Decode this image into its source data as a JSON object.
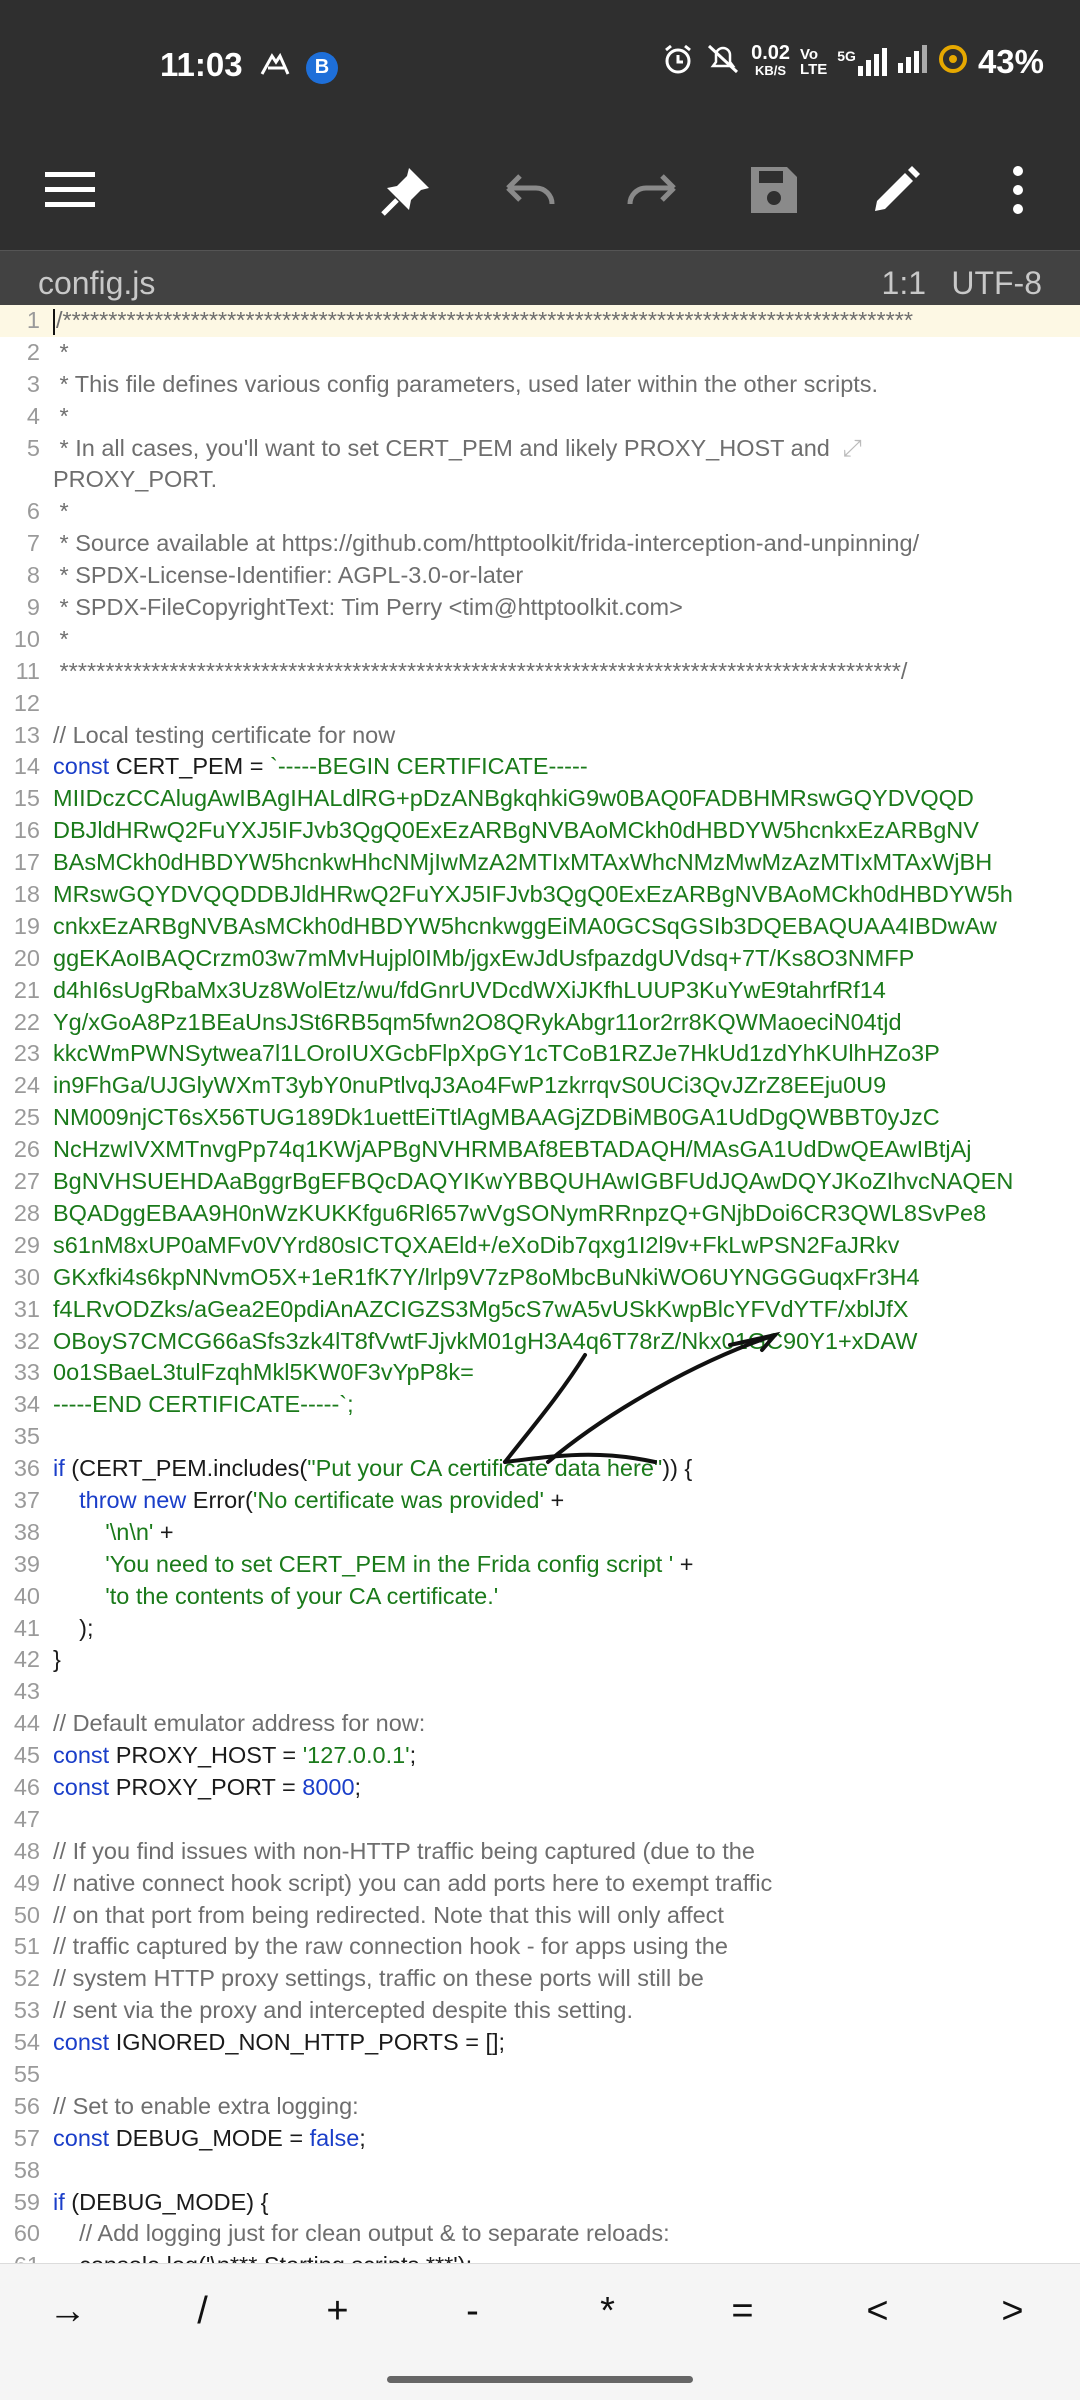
{
  "status_bar": {
    "time": "11:03",
    "net_speed_value": "0.02",
    "net_speed_unit": "KB/S",
    "vo_lte_top": "Vo",
    "vo_lte_bottom": "LTE",
    "network": "5G",
    "battery": "43%"
  },
  "toolbar": {
    "icons": [
      "menu-icon",
      "pin-icon",
      "undo-icon",
      "redo-icon",
      "save-icon",
      "edit-icon",
      "more-icon"
    ]
  },
  "file_bar": {
    "file_name": "config.js",
    "cursor_position": "1:1",
    "encoding": "UTF-8"
  },
  "code_lines": [
    {
      "n": "1",
      "type": "cmt",
      "text": "/*********************************************************************************************"
    },
    {
      "n": "2",
      "type": "cmt",
      "text": " *"
    },
    {
      "n": "3",
      "type": "cmt",
      "text": " * This file defines various config parameters, used later within the other scripts."
    },
    {
      "n": "4",
      "type": "cmt",
      "text": " *"
    },
    {
      "n": "5",
      "type": "cmt",
      "text": " * In all cases, you'll want to set CERT_PEM and likely PROXY_HOST and"
    },
    {
      "n": "",
      "type": "cmt",
      "text": "PROXY_PORT."
    },
    {
      "n": "6",
      "type": "cmt",
      "text": " *"
    },
    {
      "n": "7",
      "type": "cmt",
      "text": " * Source available at https://github.com/httptoolkit/frida-interception-and-unpinning/"
    },
    {
      "n": "8",
      "type": "cmt",
      "text": " * SPDX-License-Identifier: AGPL-3.0-or-later"
    },
    {
      "n": "9",
      "type": "cmt",
      "text": " * SPDX-FileCopyrightText: Tim Perry <tim@httptoolkit.com>"
    },
    {
      "n": "10",
      "type": "cmt",
      "text": " *"
    },
    {
      "n": "11",
      "type": "cmt",
      "text": " ********************************************************************************************/"
    },
    {
      "n": "12",
      "type": "plain",
      "text": ""
    },
    {
      "n": "13",
      "type": "cmt",
      "text": "// Local testing certificate for now"
    },
    {
      "n": "14",
      "type": "decl",
      "kw": "const",
      "name": " CERT_PEM = ",
      "str": "`-----BEGIN CERTIFICATE-----"
    },
    {
      "n": "15",
      "type": "str",
      "text": "MIIDczCCAlugAwIBAgIHALdlRG+pDzANBgkqhkiG9w0BAQ0FADBHMRswGQYDVQQD"
    },
    {
      "n": "16",
      "type": "str",
      "text": "DBJldHRwQ2FuYXJ5IFJvb3QgQ0ExEzARBgNVBAoMCkh0dHBDYW5hcnkxEzARBgNV"
    },
    {
      "n": "17",
      "type": "str",
      "text": "BAsMCkh0dHBDYW5hcnkwHhcNMjIwMzA2MTIxMTAxWhcNMzMwMzAzMTIxMTAxWjBH"
    },
    {
      "n": "18",
      "type": "str",
      "text": "MRswGQYDVQQDDBJldHRwQ2FuYXJ5IFJvb3QgQ0ExEzARBgNVBAoMCkh0dHBDYW5h"
    },
    {
      "n": "19",
      "type": "str",
      "text": "cnkxEzARBgNVBAsMCkh0dHBDYW5hcnkwggEiMA0GCSqGSIb3DQEBAQUAA4IBDwAw"
    },
    {
      "n": "20",
      "type": "str",
      "text": "ggEKAoIBAQCrzm03w7mMvHujpl0IMb/jgxEwJdUsfpazdgUVdsq+7T/Ks8O3NMFP"
    },
    {
      "n": "21",
      "type": "str",
      "text": "d4hI6sUgRbaMx3Uz8WolEtz/wu/fdGnrUVDcdWXiJKfhLUUP3KuYwE9tahrfRf14"
    },
    {
      "n": "22",
      "type": "str",
      "text": "Yg/xGoA8Pz1BEaUnsJSt6RB5qm5fwn2O8QRykAbgr11or2rr8KQWMaoeciN04tjd"
    },
    {
      "n": "23",
      "type": "str",
      "text": "kkcWmPWNSytwea7l1LOroIUXGcbFlpXpGY1cTCoB1RZJe7HkUd1zdYhKUlhHZo3P"
    },
    {
      "n": "24",
      "type": "str",
      "text": "in9FhGa/UJGlyWXmT3ybY0nuPtlvqJ3Ao4FwP1zkrrqvS0UCi3QvJZrZ8EEju0U9"
    },
    {
      "n": "25",
      "type": "str",
      "text": "NM009njCT6sX56TUG189Dk1uettEiTtlAgMBAAGjZDBiMB0GA1UdDgQWBBT0yJzC"
    },
    {
      "n": "26",
      "type": "str",
      "text": "NcHzwIVXMTnvgPp74q1KWjAPBgNVHRMBAf8EBTADAQH/MAsGA1UdDwQEAwIBtjAj"
    },
    {
      "n": "27",
      "type": "str",
      "text": "BgNVHSUEHDAaBggrBgEFBQcDAQYIKwYBBQUHAwIGBFUdJQAwDQYJKoZIhvcNAQEN"
    },
    {
      "n": "28",
      "type": "str",
      "text": "BQADggEBAA9H0nWzKUKKfgu6Rl657wVgSONymRRnpzQ+GNjbDoi6CR3QWL8SvPe8"
    },
    {
      "n": "29",
      "type": "str",
      "text": "s61nM8xUP0aMFv0VYrd80sICTQXAEld+/eXoDib7qxg1I2l9v+FkLwPSN2FaJRkv"
    },
    {
      "n": "30",
      "type": "str",
      "text": "GKxfki4s6kpNNvmO5X+1eR1fK7Y/lrlp9V7zP8oMbcBuNkiWO6UYNGGGuqxFr3H4"
    },
    {
      "n": "31",
      "type": "str",
      "text": "f4LRvODZks/aGea2E0pdiAnAZCIGZS3Mg5cS7wA5vUSkKwpBlcYFVdYTF/xblJfX"
    },
    {
      "n": "32",
      "type": "str",
      "text": "OBoyS7CMCG66aSfs3zk4lT8fVwtFJjvkM01gH3A4q6T78rZ/Nkx01GC90Y1+xDAW"
    },
    {
      "n": "33",
      "type": "str",
      "text": "0o1SBaeL3tulFzqhMkl5KW0F3vYpP8k="
    },
    {
      "n": "34",
      "type": "str",
      "text": "-----END CERTIFICATE-----`;"
    },
    {
      "n": "35",
      "type": "plain",
      "text": ""
    },
    {
      "n": "36",
      "type": "if1",
      "kw": "if",
      "pre": " (CERT_PEM.includes(",
      "str": "\"Put your CA certificate data here\"",
      "post": ")) {"
    },
    {
      "n": "37",
      "type": "throw",
      "text": ""
    },
    {
      "n": "38",
      "type": "str",
      "indent": "        ",
      "text": "'\\n\\n'",
      "post": " +"
    },
    {
      "n": "39",
      "type": "str",
      "indent": "        ",
      "text": "'You need to set CERT_PEM in the Frida config script '",
      "post": " +"
    },
    {
      "n": "40",
      "type": "str",
      "indent": "        ",
      "text": "'to the contents of your CA certificate.'",
      "post": ""
    },
    {
      "n": "41",
      "type": "plain",
      "text": "    );"
    },
    {
      "n": "42",
      "type": "plain",
      "text": "}"
    },
    {
      "n": "43",
      "type": "plain",
      "text": ""
    },
    {
      "n": "44",
      "type": "cmt",
      "text": "// Default emulator address for now:"
    },
    {
      "n": "45",
      "type": "decl",
      "kw": "const",
      "name": " PROXY_HOST = ",
      "str": "'127.0.0.1'",
      "post": ";"
    },
    {
      "n": "46",
      "type": "declnum",
      "kw": "const",
      "name": " PROXY_PORT = ",
      "num": "8000",
      "post": ";"
    },
    {
      "n": "47",
      "type": "plain",
      "text": ""
    },
    {
      "n": "48",
      "type": "cmt",
      "text": "// If you find issues with non-HTTP traffic being captured (due to the"
    },
    {
      "n": "49",
      "type": "cmt",
      "text": "// native connect hook script) you can add ports here to exempt traffic"
    },
    {
      "n": "50",
      "type": "cmt",
      "text": "// on that port from being redirected. Note that this will only affect"
    },
    {
      "n": "51",
      "type": "cmt",
      "text": "// traffic captured by the raw connection hook - for apps using the"
    },
    {
      "n": "52",
      "type": "cmt",
      "text": "// system HTTP proxy settings, traffic on these ports will still be"
    },
    {
      "n": "53",
      "type": "cmt",
      "text": "// sent via the proxy and intercepted despite this setting."
    },
    {
      "n": "54",
      "type": "decl2",
      "kw": "const",
      "name": " IGNORED_NON_HTTP_PORTS = [];"
    },
    {
      "n": "55",
      "type": "plain",
      "text": ""
    },
    {
      "n": "56",
      "type": "cmt",
      "text": "// Set to enable extra logging:"
    },
    {
      "n": "57",
      "type": "declkw",
      "kw": "const",
      "name": " DEBUG_MODE = ",
      "kw2": "false",
      "post": ";"
    },
    {
      "n": "58",
      "type": "plain",
      "text": ""
    },
    {
      "n": "59",
      "type": "if2",
      "kw": "if",
      "post": " (DEBUG_MODE) {"
    },
    {
      "n": "60",
      "type": "cmt",
      "indent": "    ",
      "text": "// Add logging just for clean output & to separate reloads:"
    },
    {
      "n": "61",
      "type": "partial",
      "text": "    console.log('\\n*** Starting scripts ***');"
    }
  ],
  "throw_line": {
    "kw_throw": "throw",
    "kw_new": "new",
    "name": " Error(",
    "str": "'No certificate was provided'",
    "post": " +"
  },
  "symbol_bar": [
    "→",
    "/",
    "+",
    "-",
    "*",
    "=",
    "<",
    ">"
  ]
}
